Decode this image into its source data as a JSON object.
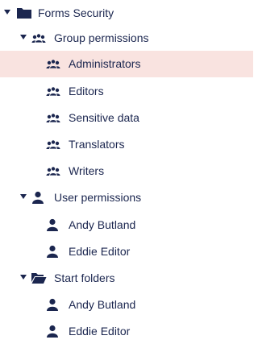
{
  "tree": {
    "root": {
      "label": "Forms Security",
      "icon": "folder-icon"
    },
    "group_permissions": {
      "label": "Group permissions",
      "icon": "users-icon",
      "items": [
        {
          "label": "Administrators",
          "icon": "users-icon",
          "selected": true
        },
        {
          "label": "Editors",
          "icon": "users-icon"
        },
        {
          "label": "Sensitive data",
          "icon": "users-icon"
        },
        {
          "label": "Translators",
          "icon": "users-icon"
        },
        {
          "label": "Writers",
          "icon": "users-icon"
        }
      ]
    },
    "user_permissions": {
      "label": "User permissions",
      "icon": "user-icon",
      "items": [
        {
          "label": "Andy Butland",
          "icon": "user-icon"
        },
        {
          "label": "Eddie Editor",
          "icon": "user-icon"
        }
      ]
    },
    "start_folders": {
      "label": "Start folders",
      "icon": "folder-open-icon",
      "items": [
        {
          "label": "Andy Butland",
          "icon": "user-icon"
        },
        {
          "label": "Eddie Editor",
          "icon": "user-icon"
        }
      ]
    }
  },
  "colors": {
    "text": "#1b264f",
    "icon": "#1b264f",
    "selected_background": "#f9e3e0"
  }
}
